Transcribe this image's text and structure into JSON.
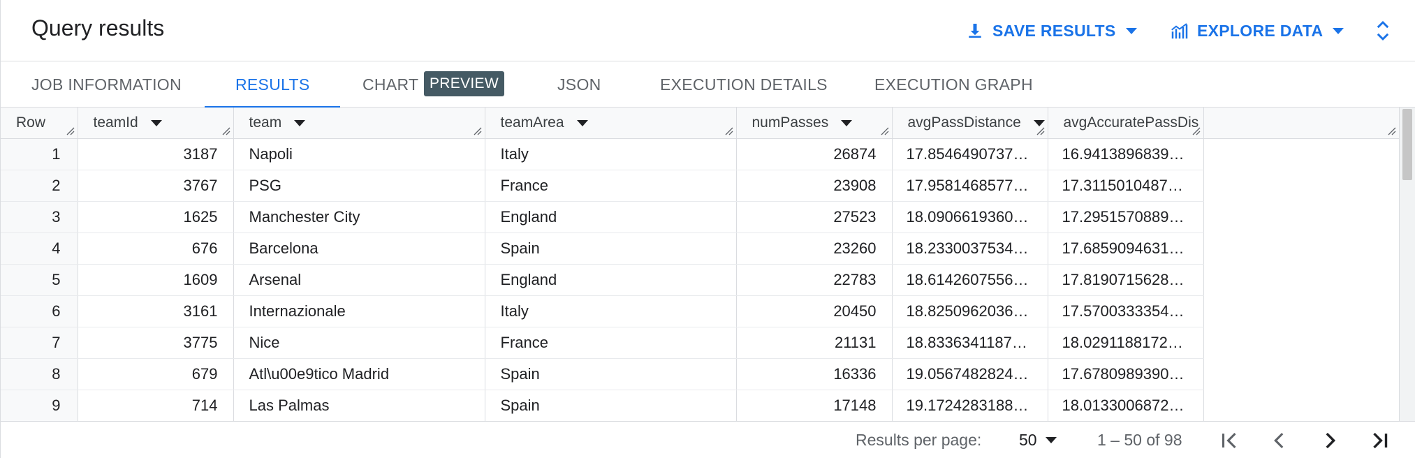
{
  "header": {
    "title": "Query results",
    "save_label": "SAVE RESULTS",
    "explore_label": "EXPLORE DATA",
    "accent": "#1a73e8"
  },
  "tabs": [
    {
      "label": "JOB INFORMATION"
    },
    {
      "label": "RESULTS",
      "active": true
    },
    {
      "label": "CHART"
    },
    {
      "label": "JSON"
    },
    {
      "label": "EXECUTION DETAILS"
    },
    {
      "label": "EXECUTION GRAPH"
    }
  ],
  "chart_badge": "PREVIEW",
  "table": {
    "row_header": "Row",
    "columns": [
      "teamId",
      "team",
      "teamArea",
      "numPasses",
      "avgPassDistance",
      "avgAccuratePassDis"
    ],
    "rows": [
      {
        "row": "1",
        "teamId": "3187",
        "team": "Napoli",
        "teamArea": "Italy",
        "numPasses": "26874",
        "avgPassDistance": "17.85464907375…",
        "avgAccuratePassDistance": "16.94138968394…"
      },
      {
        "row": "2",
        "teamId": "3767",
        "team": "PSG",
        "teamArea": "France",
        "numPasses": "23908",
        "avgPassDistance": "17.95814685772…",
        "avgAccuratePassDistance": "17.31150104876…"
      },
      {
        "row": "3",
        "teamId": "1625",
        "team": "Manchester City",
        "teamArea": "England",
        "numPasses": "27523",
        "avgPassDistance": "18.09066193601…",
        "avgAccuratePassDistance": "17.29515708892…"
      },
      {
        "row": "4",
        "teamId": "676",
        "team": "Barcelona",
        "teamArea": "Spain",
        "numPasses": "23260",
        "avgPassDistance": "18.23300375346…",
        "avgAccuratePassDistance": "17.68590946313…"
      },
      {
        "row": "5",
        "teamId": "1609",
        "team": "Arsenal",
        "teamArea": "England",
        "numPasses": "22783",
        "avgPassDistance": "18.61426075562…",
        "avgAccuratePassDistance": "17.81907156285…"
      },
      {
        "row": "6",
        "teamId": "3161",
        "team": "Internazionale",
        "teamArea": "Italy",
        "numPasses": "20450",
        "avgPassDistance": "18.82509620369…",
        "avgAccuratePassDistance": "17.57003333548…"
      },
      {
        "row": "7",
        "teamId": "3775",
        "team": "Nice",
        "teamArea": "France",
        "numPasses": "21131",
        "avgPassDistance": "18.83363411879…",
        "avgAccuratePassDistance": "18.02911881729…"
      },
      {
        "row": "8",
        "teamId": "679",
        "team": "Atl\\u00e9tico Madrid",
        "teamArea": "Spain",
        "numPasses": "16336",
        "avgPassDistance": "19.05674828240…",
        "avgAccuratePassDistance": "17.67809893905…"
      },
      {
        "row": "9",
        "teamId": "714",
        "team": "Las Palmas",
        "teamArea": "Spain",
        "numPasses": "17148",
        "avgPassDistance": "19.17242831888…",
        "avgAccuratePassDistance": "18.01330068720…"
      }
    ]
  },
  "footer": {
    "per_page_label": "Results per page:",
    "per_page_value": "50",
    "range": "1 – 50 of 98"
  }
}
